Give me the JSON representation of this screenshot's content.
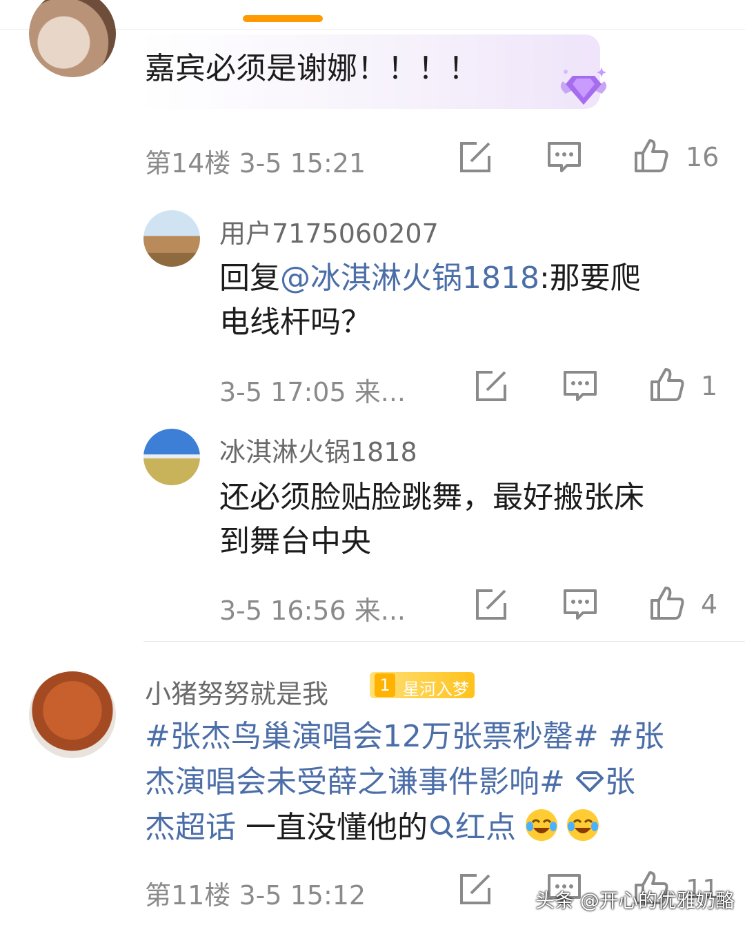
{
  "comments": [
    {
      "text": "嘉宾必须是谢娜！！！！",
      "floor": "第14楼",
      "time": "3-5 15:21",
      "likes": "16"
    },
    {
      "user": "用户7175060207",
      "reply_prefix": "回复",
      "reply_target": "@冰淇淋火锅1818",
      "text_line1": ":那要爬",
      "text_line2": "电线杆吗？",
      "time": "3-5 17:05",
      "source": "来...",
      "likes": "1"
    },
    {
      "user": "冰淇淋火锅1818",
      "text_line1": "还必须脸贴脸跳舞，最好搬张床",
      "text_line2": "到舞台中央",
      "time": "3-5 16:56",
      "source": "来...",
      "likes": "4"
    },
    {
      "user": "小猪努努就是我",
      "badge_level": "1",
      "badge_label": "星河入梦",
      "topic1": "#张杰鸟巢演唱会12万张票秒罄#",
      "topic2_part1": "#张",
      "topic2_part2": "杰演唱会未受薛之谦事件影响#",
      "supertopic_part1": "张",
      "supertopic_part2": "杰超话",
      "text": "一直没懂他的",
      "search_link": "红点",
      "floor": "第11楼",
      "time": "3-5 15:12",
      "likes": "11"
    }
  ],
  "watermark": "头条 @开心的优雅奶酪",
  "colors": {
    "accent": "#ff9a00",
    "link": "#4b6ea8",
    "badge": "#ffc21c"
  },
  "icons": [
    "share-icon",
    "comment-icon",
    "like-icon",
    "supertopic-icon",
    "search-icon",
    "laugh-cry-emoji",
    "gem-badge-icon"
  ]
}
